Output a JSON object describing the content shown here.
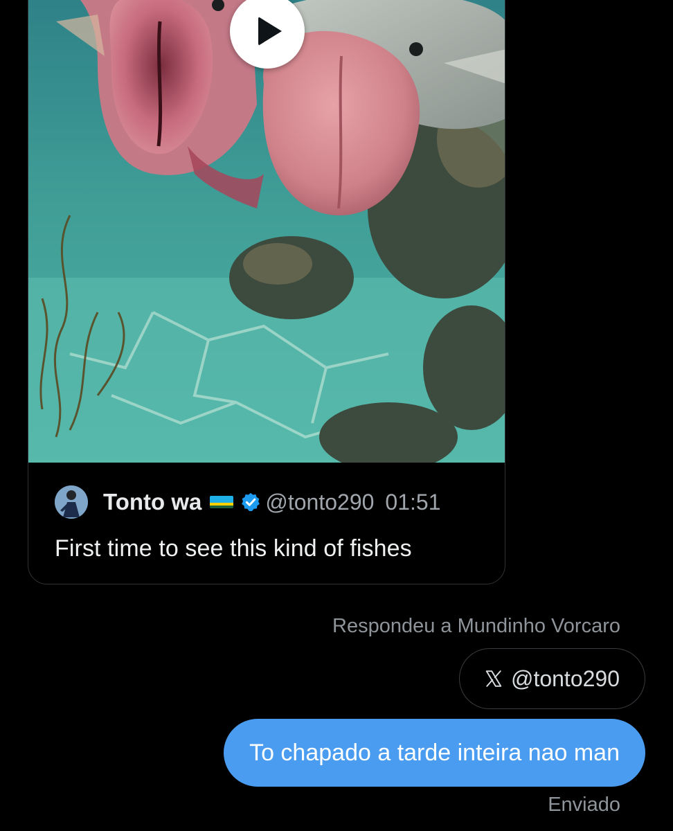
{
  "tweet": {
    "author_name": "Tonto wa",
    "handle": "@tonto290",
    "time": "01:51",
    "text": "First time to see this kind of fishes",
    "flag_colors": [
      "#1eb0e6",
      "#fad201",
      "#20603d"
    ],
    "verified_color": "#1d9bf0"
  },
  "conversation": {
    "reply_context": "Respondeu a Mundinho Vorcaro",
    "mention": "@tonto290",
    "message": "To chapado a tarde inteira nao man",
    "status": "Enviado",
    "bubble_color": "#4a9cf0"
  }
}
